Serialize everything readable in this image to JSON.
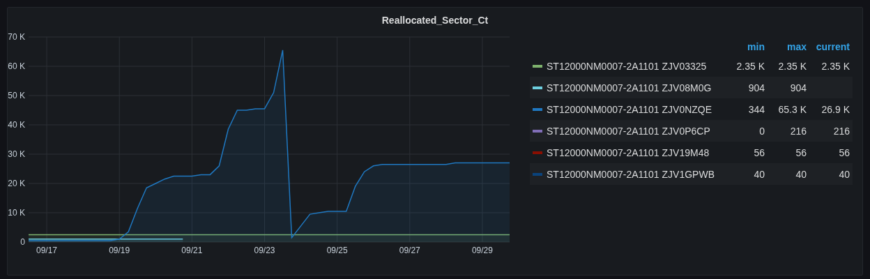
{
  "panel": {
    "title": "Reallocated_Sector_Ct",
    "chart_data": {
      "type": "area",
      "grid": true,
      "categories": [
        null,
        null,
        "09/17",
        null,
        null,
        null,
        null,
        null,
        null,
        null,
        "09/19",
        null,
        null,
        null,
        null,
        null,
        null,
        null,
        "09/21",
        null,
        null,
        null,
        null,
        null,
        null,
        null,
        "09/23",
        null,
        null,
        null,
        null,
        null,
        null,
        null,
        "09/25",
        null,
        null,
        null,
        null,
        null,
        null,
        null,
        "09/27",
        null,
        null,
        null,
        null,
        null,
        null,
        null,
        "09/29",
        null,
        null,
        null
      ],
      "series": [
        {
          "name": "ST12000NM0007-2A1101 ZJV03325",
          "color": "#7eb26d",
          "values": [
            2500,
            2500,
            2500,
            2500,
            2500,
            2500,
            2500,
            2500,
            2500,
            2500,
            2500,
            2500,
            2500,
            2500,
            2500,
            2500,
            2500,
            2500,
            2500,
            2500,
            2500,
            2500,
            2500,
            2500,
            2500,
            2500,
            2500,
            2500,
            2500,
            2500,
            2500,
            2500,
            2500,
            2500,
            2500,
            2500,
            2500,
            2500,
            2500,
            2500,
            2500,
            2500,
            2500,
            2500,
            2500,
            2500,
            2500,
            2500,
            2500,
            2500,
            2500,
            2500,
            2500,
            2500
          ]
        },
        {
          "name": "ST12000NM0007-2A1101 ZJV08M0G",
          "color": "#6ed0e0",
          "values": [
            1000,
            1000,
            1000,
            1000,
            1000,
            1000,
            1000,
            1000,
            1000,
            1000,
            1000,
            1000,
            1000,
            1000,
            1000,
            1000,
            1000,
            1000,
            null,
            null,
            null,
            null,
            null,
            null,
            null,
            null,
            null,
            null,
            null,
            null,
            null,
            null,
            null,
            null,
            null,
            null,
            null,
            null,
            null,
            null,
            null,
            null,
            null,
            null,
            null,
            null,
            null,
            null,
            null,
            null,
            null,
            null,
            null,
            null
          ]
        },
        {
          "name": "ST12000NM0007-2A1101 ZJV0NZQE",
          "color": "#1f78c1",
          "values": [
            500,
            500,
            500,
            500,
            500,
            500,
            500,
            500,
            500,
            500,
            1000,
            3500,
            11500,
            18500,
            20000,
            21500,
            22500,
            22500,
            22500,
            23000,
            23000,
            26000,
            38500,
            45000,
            45000,
            45500,
            45500,
            51000,
            65500,
            1500,
            5500,
            9500,
            10000,
            10500,
            10500,
            10500,
            19000,
            24000,
            26000,
            26500,
            26500,
            26500,
            26500,
            26500,
            26500,
            26500,
            26500,
            27000,
            27000,
            27000,
            27000,
            27000,
            27000,
            27000
          ]
        },
        {
          "name": "ST12000NM0007-2A1101 ZJV0P6CP",
          "color": "#806eb7",
          "values": [
            null,
            null,
            null,
            null,
            null,
            null,
            null,
            null,
            null,
            null,
            null,
            null,
            null,
            null,
            null,
            null,
            null,
            null,
            null,
            null,
            null,
            null,
            null,
            null,
            null,
            null,
            null,
            null,
            null,
            null,
            null,
            null,
            null,
            null,
            null,
            null,
            null,
            null,
            null,
            null,
            null,
            null,
            null,
            null,
            null,
            null,
            null,
            null,
            null,
            null,
            null,
            null,
            null,
            null
          ]
        },
        {
          "name": "ST12000NM0007-2A1101 ZJV19M48",
          "color": "#890f02",
          "values": [
            null,
            null,
            null,
            null,
            null,
            null,
            null,
            null,
            null,
            null,
            null,
            null,
            null,
            null,
            null,
            null,
            null,
            null,
            null,
            null,
            null,
            null,
            null,
            null,
            null,
            null,
            null,
            null,
            null,
            null,
            null,
            null,
            null,
            null,
            null,
            null,
            null,
            null,
            null,
            null,
            null,
            null,
            null,
            null,
            null,
            null,
            null,
            null,
            null,
            null,
            null,
            null,
            null,
            null
          ]
        },
        {
          "name": "ST12000NM0007-2A1101 ZJV1GPWB",
          "color": "#0a437c",
          "values": [
            null,
            null,
            null,
            null,
            null,
            null,
            null,
            null,
            null,
            null,
            null,
            null,
            null,
            null,
            null,
            null,
            null,
            null,
            null,
            null,
            null,
            null,
            null,
            null,
            null,
            null,
            null,
            null,
            null,
            null,
            null,
            null,
            null,
            null,
            null,
            null,
            null,
            null,
            null,
            null,
            null,
            null,
            null,
            null,
            null,
            null,
            null,
            null,
            null,
            null,
            null,
            null,
            null,
            null
          ]
        }
      ],
      "ylim": [
        0,
        70000
      ],
      "yticks": [
        {
          "value": 0,
          "label": "0"
        },
        {
          "value": 10000,
          "label": "10 K"
        },
        {
          "value": 20000,
          "label": "20 K"
        },
        {
          "value": 30000,
          "label": "30 K"
        },
        {
          "value": 40000,
          "label": "40 K"
        },
        {
          "value": 50000,
          "label": "50 K"
        },
        {
          "value": 60000,
          "label": "60 K"
        },
        {
          "value": 70000,
          "label": "70 K"
        }
      ]
    },
    "legend": {
      "columns": [
        "min",
        "max",
        "current"
      ],
      "rows": [
        {
          "min": "2.35 K",
          "max": "2.35 K",
          "current": "2.35 K"
        },
        {
          "min": "904",
          "max": "904"
        },
        {
          "min": "344",
          "max": "65.3 K",
          "current": "26.9 K"
        },
        {
          "min": "0",
          "max": "216",
          "current": "216"
        },
        {
          "min": "56",
          "max": "56",
          "current": "56"
        },
        {
          "min": "40",
          "max": "40",
          "current": "40"
        }
      ]
    }
  }
}
